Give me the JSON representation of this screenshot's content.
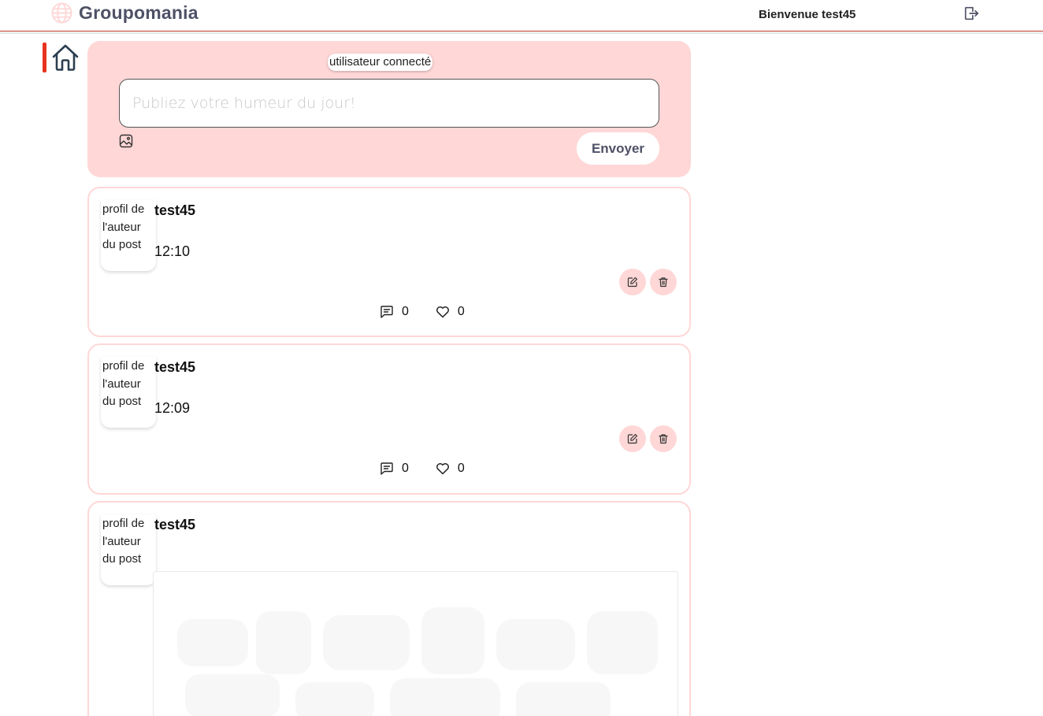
{
  "header": {
    "app_name": "Groupomania",
    "welcome": "Bienvenue test45",
    "logout_icon": "logout-icon",
    "logo_icon": "globe-icon"
  },
  "sidebar": {
    "home_icon": "home-icon",
    "active_color": "#e8331e"
  },
  "composer": {
    "current_user_alt": "utilisateur connecté",
    "placeholder": "Publiez votre humeur du jour!",
    "image_icon": "image-icon",
    "send_label": "Envoyer",
    "background": "#ffd7d7"
  },
  "posts": [
    {
      "avatar_alt": "profil de l'auteur du post",
      "author": "test45",
      "time": "12:10",
      "comments": "0",
      "likes": "0"
    },
    {
      "avatar_alt": "profil de l'auteur du post",
      "author": "test45",
      "time": "12:09",
      "comments": "0",
      "likes": "0"
    },
    {
      "avatar_alt": "profil de l'auteur du post",
      "author": "test45"
    }
  ],
  "colors": {
    "accent_pink": "#ffd7d7",
    "brand_dark": "#4e5166",
    "brand_red": "#fd2d01"
  }
}
